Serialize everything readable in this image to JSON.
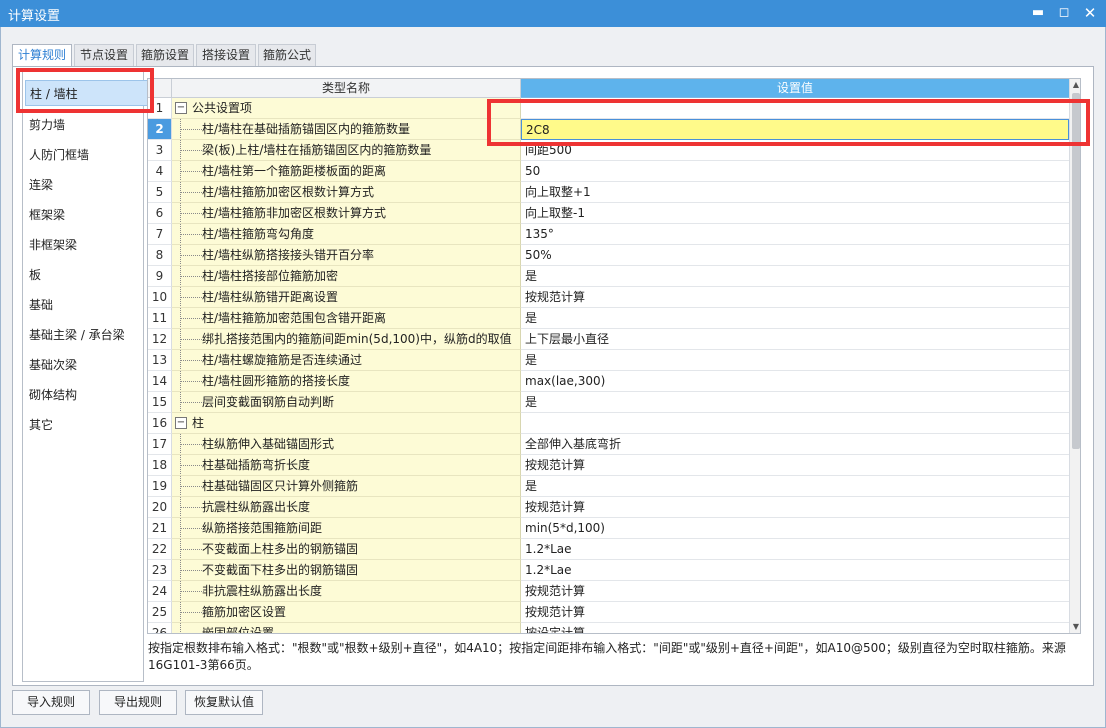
{
  "window": {
    "title": "计算设置",
    "min_glyph": "▬",
    "max_glyph": "◻",
    "close_glyph": "✕"
  },
  "tabs": [
    {
      "label": "计算规则",
      "active": true
    },
    {
      "label": "节点设置"
    },
    {
      "label": "箍筋设置"
    },
    {
      "label": "搭接设置"
    },
    {
      "label": "箍筋公式"
    }
  ],
  "sidebar": {
    "items": [
      {
        "label": "柱 / 墙柱",
        "active": true
      },
      {
        "label": "剪力墙"
      },
      {
        "label": "人防门框墙"
      },
      {
        "label": "连梁"
      },
      {
        "label": "框架梁"
      },
      {
        "label": "非框架梁"
      },
      {
        "label": "板"
      },
      {
        "label": "基础"
      },
      {
        "label": "基础主梁 / 承台梁"
      },
      {
        "label": "基础次梁"
      },
      {
        "label": "砌体结构"
      },
      {
        "label": "其它"
      }
    ]
  },
  "grid": {
    "header_name": "类型名称",
    "header_value": "设置值",
    "toggle_glyph": "−",
    "rows": [
      {
        "num": "1",
        "name": "公共设置项",
        "value": "",
        "group": true
      },
      {
        "num": "2",
        "name": "柱/墙柱在基础插筋锚固区内的箍筋数量",
        "value": "2C8",
        "selected": true
      },
      {
        "num": "3",
        "name": "梁(板)上柱/墙柱在插筋锚固区内的箍筋数量",
        "value": "间距500"
      },
      {
        "num": "4",
        "name": "柱/墙柱第一个箍筋距楼板面的距离",
        "value": "50"
      },
      {
        "num": "5",
        "name": "柱/墙柱箍筋加密区根数计算方式",
        "value": "向上取整+1"
      },
      {
        "num": "6",
        "name": "柱/墙柱箍筋非加密区根数计算方式",
        "value": "向上取整-1"
      },
      {
        "num": "7",
        "name": "柱/墙柱箍筋弯勾角度",
        "value": "135°"
      },
      {
        "num": "8",
        "name": "柱/墙柱纵筋搭接接头错开百分率",
        "value": "50%"
      },
      {
        "num": "9",
        "name": "柱/墙柱搭接部位箍筋加密",
        "value": "是"
      },
      {
        "num": "10",
        "name": "柱/墙柱纵筋错开距离设置",
        "value": "按规范计算"
      },
      {
        "num": "11",
        "name": "柱/墙柱箍筋加密范围包含错开距离",
        "value": "是"
      },
      {
        "num": "12",
        "name": "绑扎搭接范围内的箍筋间距min(5d,100)中，纵筋d的取值",
        "value": "上下层最小直径"
      },
      {
        "num": "13",
        "name": "柱/墙柱螺旋箍筋是否连续通过",
        "value": "是"
      },
      {
        "num": "14",
        "name": "柱/墙柱圆形箍筋的搭接长度",
        "value": "max(lae,300)"
      },
      {
        "num": "15",
        "name": "层间变截面钢筋自动判断",
        "value": "是"
      },
      {
        "num": "16",
        "name": "柱",
        "value": "",
        "group": true
      },
      {
        "num": "17",
        "name": "柱纵筋伸入基础锚固形式",
        "value": "全部伸入基底弯折"
      },
      {
        "num": "18",
        "name": "柱基础插筋弯折长度",
        "value": "按规范计算"
      },
      {
        "num": "19",
        "name": "柱基础锚固区只计算外侧箍筋",
        "value": "是"
      },
      {
        "num": "20",
        "name": "抗震柱纵筋露出长度",
        "value": "按规范计算"
      },
      {
        "num": "21",
        "name": "纵筋搭接范围箍筋间距",
        "value": "min(5*d,100)"
      },
      {
        "num": "22",
        "name": "不变截面上柱多出的钢筋锚固",
        "value": "1.2*Lae"
      },
      {
        "num": "23",
        "name": "不变截面下柱多出的钢筋锚固",
        "value": "1.2*Lae"
      },
      {
        "num": "24",
        "name": "非抗震柱纵筋露出长度",
        "value": "按规范计算"
      },
      {
        "num": "25",
        "name": "箍筋加密区设置",
        "value": "按规范计算"
      },
      {
        "num": "26",
        "name": "嵌固部位设置",
        "value": "按设定计算"
      }
    ]
  },
  "note": "按指定根数排布输入格式：\"根数\"或\"根数+级别+直径\"，如4A10；按指定间距排布输入格式：\"间距\"或\"级别+直径+间距\"，如A10@500；级别直径为空时取柱箍筋。来源16G101-3第66页。",
  "buttons": {
    "import": "导入规则",
    "export": "导出规则",
    "restore": "恢复默认值"
  },
  "scroll": {
    "up_glyph": "▲",
    "down_glyph": "▼"
  },
  "colors": {
    "titlebar": "#3c8fd8",
    "header_value": "#5eb3ec",
    "name_column": "#fdfbd6",
    "selected_value": "#fffa8a",
    "annotation_box": "#ee3333"
  }
}
